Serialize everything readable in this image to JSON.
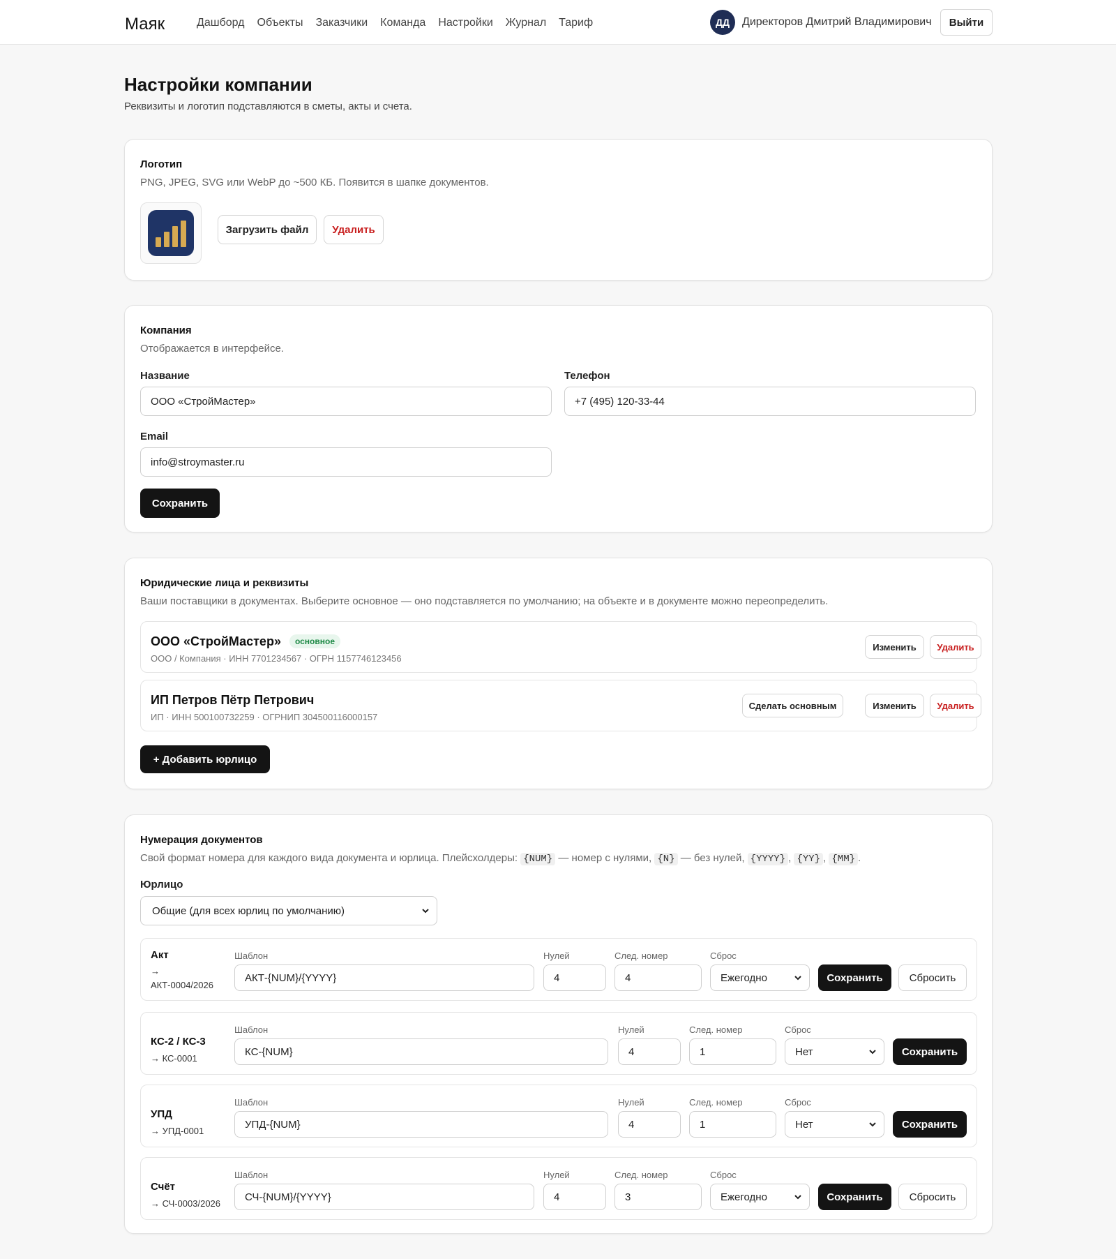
{
  "app": {
    "brand": "Маяк"
  },
  "nav": {
    "items": [
      "Дашборд",
      "Объекты",
      "Заказчики",
      "Команда",
      "Настройки",
      "Журнал",
      "Тариф"
    ]
  },
  "user": {
    "initials": "ДД",
    "name": "Директоров Дмитрий Владимирович",
    "logout_label": "Выйти"
  },
  "colors": {
    "primary": "#141414",
    "danger": "#c81e1e",
    "success": "#1e8a46",
    "avatar": "#1f2d55",
    "logo_bg": "#1f3466",
    "logo_bars": "#d7aa52"
  },
  "page": {
    "title": "Настройки компании",
    "subtitle": "Реквизиты и логотип подставляются в сметы, акты и счета."
  },
  "logo_section": {
    "title": "Логотип",
    "description": "PNG, JPEG, SVG или WebP до ~500 КБ. Появится в шапке документов.",
    "upload_label": "Загрузить файл",
    "delete_label": "Удалить",
    "icon": "bar-chart-logo"
  },
  "company_section": {
    "title": "Компания",
    "description": "Отображается в интерфейсе.",
    "name_label": "Название",
    "name_value": "ООО «СтройМастер»",
    "phone_label": "Телефон",
    "phone_value": "+7 (495) 120-33-44",
    "email_label": "Email",
    "email_value": "info@stroymaster.ru",
    "save_label": "Сохранить"
  },
  "legal_section": {
    "title": "Юридические лица и реквизиты",
    "description": "Ваши поставщики в документах. Выберите основное — оно подставляется по умолчанию; на объекте и в документе можно переопределить.",
    "entities": [
      {
        "name": "ООО «СтройМастер»",
        "badge": "основное",
        "meta": "ООО / Компания · ИНН 7701234567 · ОГРН 1157746123456",
        "edit_label": "Изменить",
        "delete_label": "Удалить"
      },
      {
        "name": "ИП Петров Пётр Петрович",
        "meta": "ИП · ИНН 500100732259 · ОГРНИП 304500116000157",
        "make_main_label": "Сделать основным",
        "edit_label": "Изменить",
        "delete_label": "Удалить"
      }
    ],
    "add_label": "+ Добавить юрлицо"
  },
  "numbering_section": {
    "title": "Нумерация документов",
    "desc_parts": [
      "Свой формат номера для каждого вида документа и юрлица. Плейсхолдеры: ",
      "{NUM}",
      " — номер с нулями, ",
      "{N}",
      " — без нулей, ",
      "{YYYY}",
      ", ",
      "{YY}",
      ", ",
      "{MM}",
      "."
    ],
    "entity_label": "Юрлицо",
    "entity_selected": "Общие (для всех юрлиц по умолчанию)",
    "col_template": "Шаблон",
    "col_zeros": "Нулей",
    "col_next": "След. номер",
    "col_reset": "Сброс",
    "save_label": "Сохранить",
    "reset_label": "Сбросить",
    "rows": [
      {
        "title": "Акт",
        "preview": "→",
        "preview2": "АКТ-0004/2026",
        "template": "АКТ-{NUM}/{YYYY}",
        "zeros": "4",
        "next": "4",
        "reset": "Ежегодно"
      },
      {
        "title": "КС-2 / КС-3",
        "preview": "→ КС-0001",
        "template": "КС-{NUM}",
        "zeros": "4",
        "next": "1",
        "reset": "Нет"
      },
      {
        "title": "УПД",
        "preview": "→ УПД-0001",
        "template": "УПД-{NUM}",
        "zeros": "4",
        "next": "1",
        "reset": "Нет"
      },
      {
        "title": "Счёт",
        "preview": "→ СЧ-0003/2026",
        "template": "СЧ-{NUM}/{YYYY}",
        "zeros": "4",
        "next": "3",
        "reset": "Ежегодно"
      }
    ]
  }
}
